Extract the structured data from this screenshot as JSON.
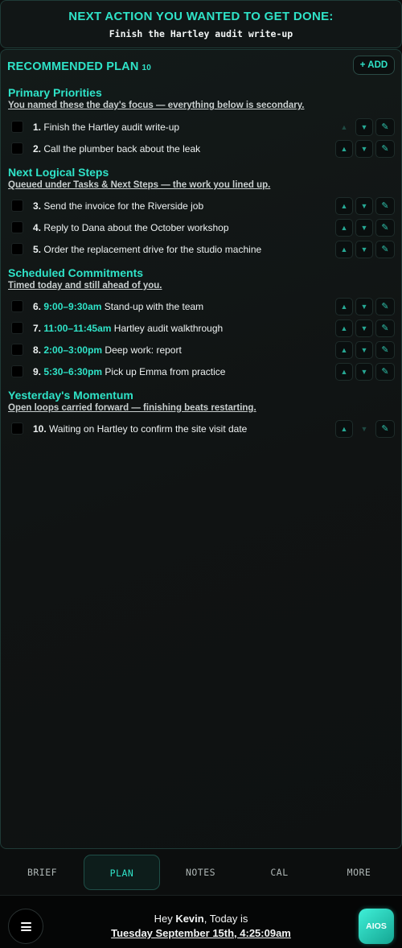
{
  "next_action": {
    "title": "NEXT ACTION YOU WANTED TO GET DONE:",
    "task": "Finish the Hartley audit write-up"
  },
  "plan": {
    "title": "RECOMMENDED PLAN",
    "count": "10",
    "add_label": "+ ADD",
    "sections": [
      {
        "title": "Primary Priorities",
        "subtitle": "You named these the day's focus — everything below is secondary.",
        "tasks": [
          {
            "num": "1.",
            "time": "",
            "text": "Finish the Hartley audit write-up"
          },
          {
            "num": "2.",
            "time": "",
            "text": "Call the plumber back about the leak"
          }
        ]
      },
      {
        "title": "Next Logical Steps",
        "subtitle": "Queued under Tasks & Next Steps — the work you lined up.",
        "tasks": [
          {
            "num": "3.",
            "time": "",
            "text": "Send the invoice for the Riverside job"
          },
          {
            "num": "4.",
            "time": "",
            "text": "Reply to Dana about the October workshop"
          },
          {
            "num": "5.",
            "time": "",
            "text": "Order the replacement drive for the studio machine"
          }
        ]
      },
      {
        "title": "Scheduled Commitments",
        "subtitle": "Timed today and still ahead of you.",
        "tasks": [
          {
            "num": "6.",
            "time": "9:00–9:30am",
            "text": "Stand-up with the team"
          },
          {
            "num": "7.",
            "time": "11:00–11:45am",
            "text": "Hartley audit walkthrough"
          },
          {
            "num": "8.",
            "time": "2:00–3:00pm",
            "text": "Deep work: report"
          },
          {
            "num": "9.",
            "time": "5:30–6:30pm",
            "text": "Pick up Emma from practice"
          }
        ]
      },
      {
        "title": "Yesterday's Momentum",
        "subtitle": "Open loops carried forward — finishing beats restarting.",
        "tasks": [
          {
            "num": "10.",
            "time": "",
            "text": "Waiting on Hartley to confirm the site visit date"
          }
        ]
      }
    ],
    "controls": {
      "up_icon": "▲",
      "down_icon": "▼",
      "edit_icon": "✎"
    }
  },
  "nav": {
    "tabs": [
      "BRIEF",
      "PLAN",
      "NOTES",
      "CAL",
      "MORE"
    ],
    "active": "PLAN"
  },
  "footer": {
    "greeting_prefix": "Hey ",
    "user_name": "Kevin",
    "greeting_suffix": ", Today is",
    "date_time": "Tuesday September 15th, 4:25:09am",
    "badge": "AIOS"
  },
  "colors": {
    "accent": "#2fe3c8",
    "background": "#0c0e0e"
  }
}
